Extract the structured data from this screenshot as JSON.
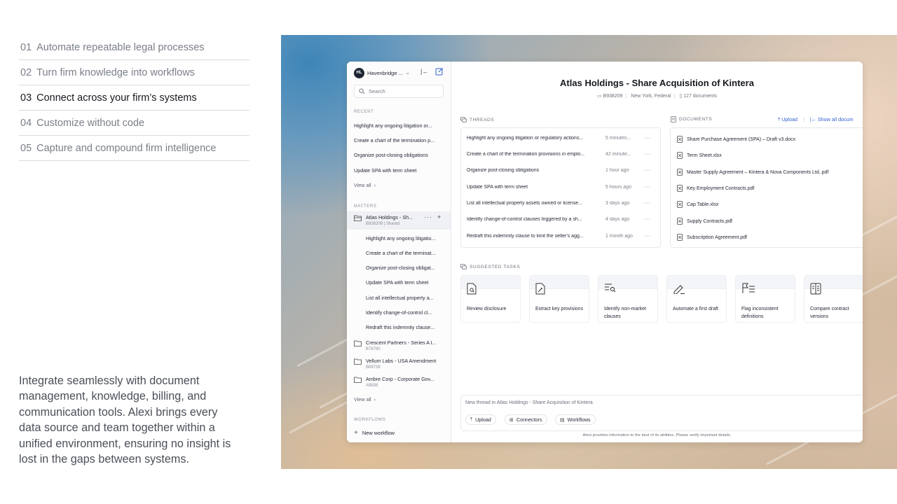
{
  "features": [
    {
      "num": "01",
      "label": "Automate repeatable legal processes"
    },
    {
      "num": "02",
      "label": "Turn firm knowledge into workflows"
    },
    {
      "num": "03",
      "label": "Connect across your firm’s systems"
    },
    {
      "num": "04",
      "label": "Customize without code"
    },
    {
      "num": "05",
      "label": "Capture and compound firm intelligence"
    }
  ],
  "blurb": "Integrate seamlessly with document management, knowledge, billing, and communication tools. Alexi brings every data source and team together within a unified environment, ensuring no insight is lost in the gaps between systems.",
  "sidebar": {
    "avatar": "HL",
    "workspace": "Havenbridge ...",
    "search_placeholder": "Search",
    "recent_label": "RECENT",
    "recent": [
      "Highlight any ongoing litigation or...",
      "Create a chart of the termination p...",
      "Organize post-closing obligations",
      "Update SPA with term sheet"
    ],
    "view_all": "View all",
    "matters_label": "MATTERS",
    "active_matter": {
      "name": "Atlas Holdings - Sh...",
      "sub": "B938209  |  Shared"
    },
    "active_threads": [
      "Highlight any ongoing litigatio...",
      "Create a chart of the terminat...",
      "Organize post-closing obligat...",
      "Update SPA with term sheet",
      "List all intellectual property a...",
      "Identify change-of-control cl...",
      "Redraft this indemnity clause..."
    ],
    "matters": [
      {
        "name": "Crescent Partners - Series A I...",
        "sub": "B76790"
      },
      {
        "name": "Vellum Labs - USA Amendment",
        "sub": "B89738"
      },
      {
        "name": "Ambre Corp - Corporate Gov...",
        "sub": "A9838"
      }
    ],
    "view_all_2": "View all",
    "workflows_label": "WORKFLOWS",
    "new_workflow": "New workflow"
  },
  "main": {
    "title": "Atlas Holdings - Share Acquisition of Kintera",
    "matter_id": "B938209",
    "jurisdiction": "New York, Federal",
    "doc_count": "127 documents",
    "threads_label": "THREADS",
    "threads": [
      {
        "title": "Highlight any ongoing litigation or regulatory actions...",
        "time": "5 minutes..."
      },
      {
        "title": "Create a chart of the termination provisions in emplo...",
        "time": "42 minute..."
      },
      {
        "title": "Organize post-closing obligations",
        "time": "1 hour ago"
      },
      {
        "title": "Update SPA with term sheet",
        "time": "5 hours ago"
      },
      {
        "title": "List all intellectual property assets owned or license...",
        "time": "3 days ago"
      },
      {
        "title": "Identify change-of-control clauses triggered by a sh...",
        "time": "4 days ago"
      },
      {
        "title": "Redraft this indemnity clause to limit the seller's agg...",
        "time": "1 month ago"
      }
    ],
    "documents_label": "DOCUMENTS",
    "upload_label": "Upload",
    "show_all_label": "Show all docum",
    "documents": [
      "Share Purchase Agreement (SPA) – Draft v3.docx",
      "Term Sheet.xlsx",
      "Master Supply Agreement – Kintera & Nova Components Ltd..pdf",
      "Key Employment Contracts.pdf",
      "Cap Table.xlsx",
      "Supply Contracts.pdf",
      "Subscription Agreement.pdf"
    ],
    "tasks_label": "SUGGESTED TASKS",
    "tasks": [
      {
        "label": "Review disclosure",
        "icon": "doc-search-icon"
      },
      {
        "label": "Extract key provisions",
        "icon": "doc-extract-icon"
      },
      {
        "label": "Identify non-market clauses",
        "icon": "list-search-icon"
      },
      {
        "label": "Automate a first draft",
        "icon": "pen-icon"
      },
      {
        "label": "Flag inconsistent definitions",
        "icon": "flag-icon"
      },
      {
        "label": "Compare contract versions",
        "icon": "compare-icon"
      }
    ],
    "composer_placeholder": "New thread in Atlas Holdings - Share Acquisition of Kintera",
    "chip_upload": "Upload",
    "chip_connectors": "Connectors",
    "chip_workflows": "Workflows",
    "disclaimer": "Alexi provides information to the best of its abilities. Please verify important details."
  },
  "colors": {
    "accent": "#2f5fd0",
    "avatar_bg": "#1c2433"
  }
}
